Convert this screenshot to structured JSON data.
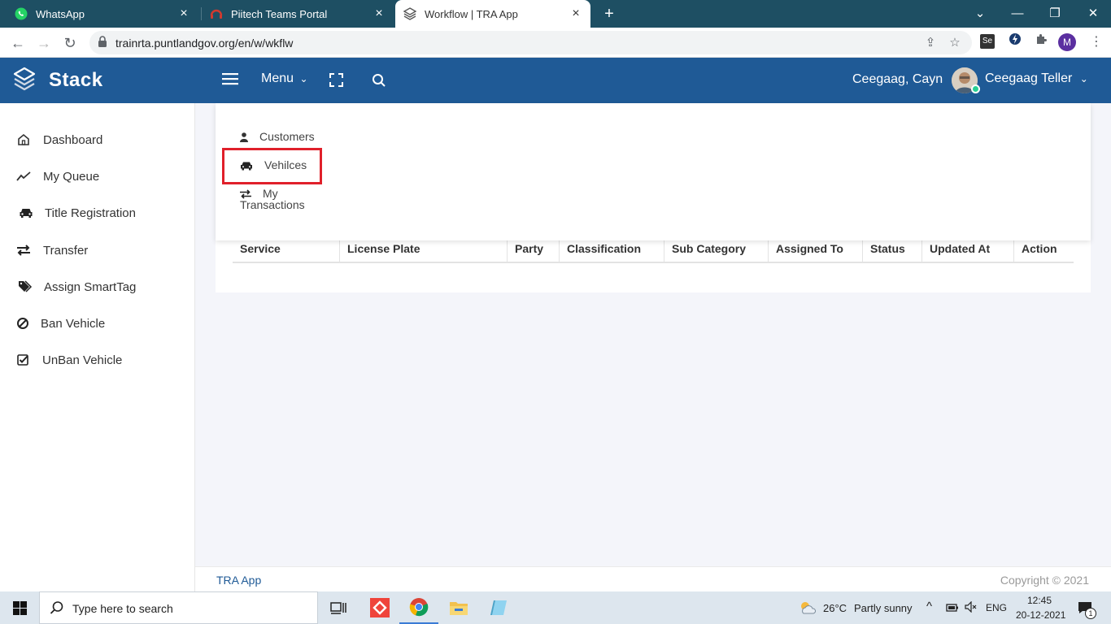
{
  "browser": {
    "tabs": [
      {
        "title": "WhatsApp",
        "icon": "whatsapp-icon"
      },
      {
        "title": "Piitech Teams Portal",
        "icon": "headset-icon"
      },
      {
        "title": "Workflow | TRA App",
        "icon": "stack-logo-icon",
        "active": true
      }
    ],
    "url": "trainrta.puntlandgov.org/en/w/wkflw",
    "profile_initial": "M",
    "extension_se": "Se"
  },
  "header": {
    "brand": "Stack",
    "menu_label": "Menu",
    "user_short": "Ceegaag, Cayn",
    "user_name": "Ceegaag Teller"
  },
  "sidebar": {
    "items": [
      {
        "label": "Dashboard",
        "icon": "home-icon"
      },
      {
        "label": "My Queue",
        "icon": "trend-line-icon"
      },
      {
        "label": "Title Registration",
        "icon": "car-icon"
      },
      {
        "label": "Transfer",
        "icon": "exchange-icon"
      },
      {
        "label": "Assign SmartTag",
        "icon": "tags-icon"
      },
      {
        "label": "Ban Vehicle",
        "icon": "ban-icon"
      },
      {
        "label": "UnBan Vehicle",
        "icon": "check-square-icon"
      }
    ]
  },
  "menu_dropdown": {
    "items": [
      {
        "label": "Customers",
        "icon": "user-icon"
      },
      {
        "label": "Vehilces",
        "icon": "car-icon",
        "highlighted": true
      },
      {
        "label_line1": "My",
        "label_line2": "Transactions",
        "icon": "exchange-icon"
      }
    ]
  },
  "table": {
    "columns": [
      "Service",
      "License Plate",
      "Party",
      "Classification",
      "Sub Category",
      "Assigned To",
      "Status",
      "Updated At",
      "Action"
    ]
  },
  "footer": {
    "left": "TRA App",
    "right": "Copyright © 2021"
  },
  "taskbar": {
    "search_placeholder": "Type here to search",
    "weather_temp": "26°C",
    "weather_desc": "Partly sunny",
    "lang": "ENG",
    "time": "12:45",
    "date": "20-12-2021",
    "notification_count": "1"
  },
  "colors": {
    "app_header": "#1f5a96",
    "tab_strip": "#1e4f63",
    "highlight": "#e0202a",
    "online": "#28d094"
  }
}
